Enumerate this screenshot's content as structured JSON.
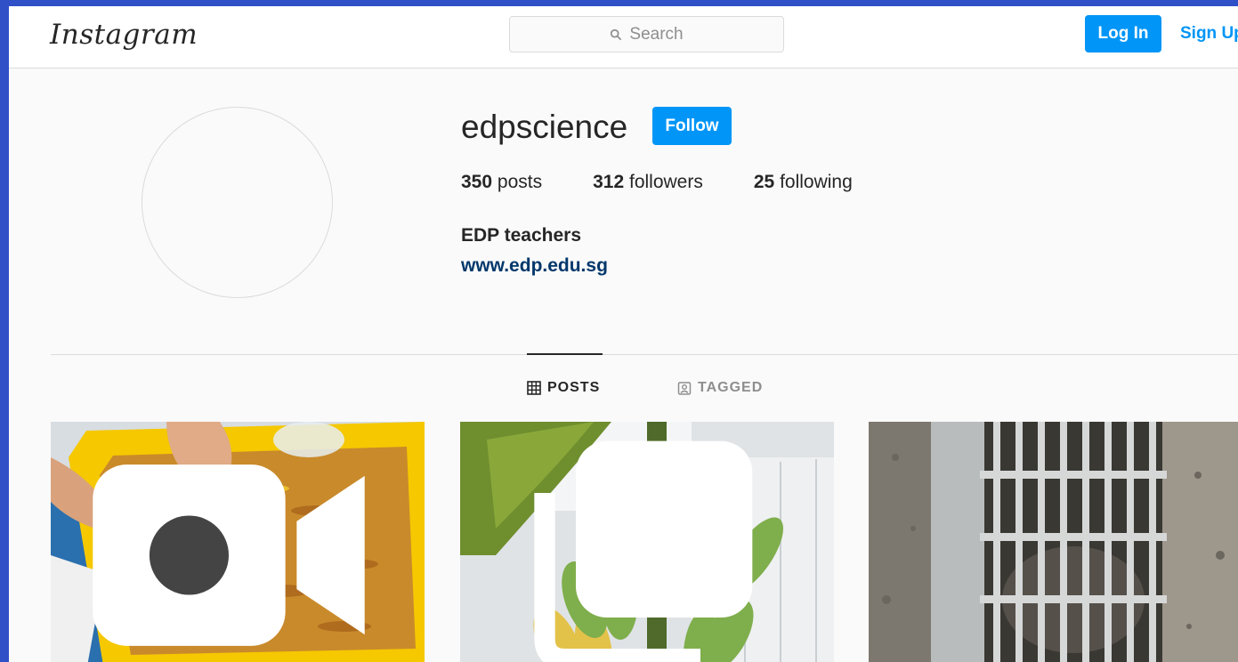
{
  "header": {
    "logo": "Instagram",
    "search_placeholder": "Search",
    "login_label": "Log In",
    "signup_label": "Sign Up"
  },
  "profile": {
    "username": "edpscience",
    "follow_label": "Follow",
    "stats": [
      {
        "count": "350",
        "label": "posts"
      },
      {
        "count": "312",
        "label": "followers"
      },
      {
        "count": "25",
        "label": "following"
      }
    ],
    "bio_name": "EDP teachers",
    "bio_link": "www.edp.edu.sg"
  },
  "tabs": [
    {
      "label": "POSTS",
      "icon": "grid-icon",
      "active": true
    },
    {
      "label": "TAGGED",
      "icon": "tagged-icon",
      "active": false
    }
  ],
  "posts": [
    {
      "subject": "mealworms-in-yellow-tray",
      "badge": "video-icon"
    },
    {
      "subject": "banana-bunch",
      "badge": "carousel-icon"
    },
    {
      "subject": "drain-grate",
      "badge": ""
    }
  ],
  "colors": {
    "accent": "#0095f6",
    "link": "#00376b",
    "frame_bg": "#3050c8"
  }
}
